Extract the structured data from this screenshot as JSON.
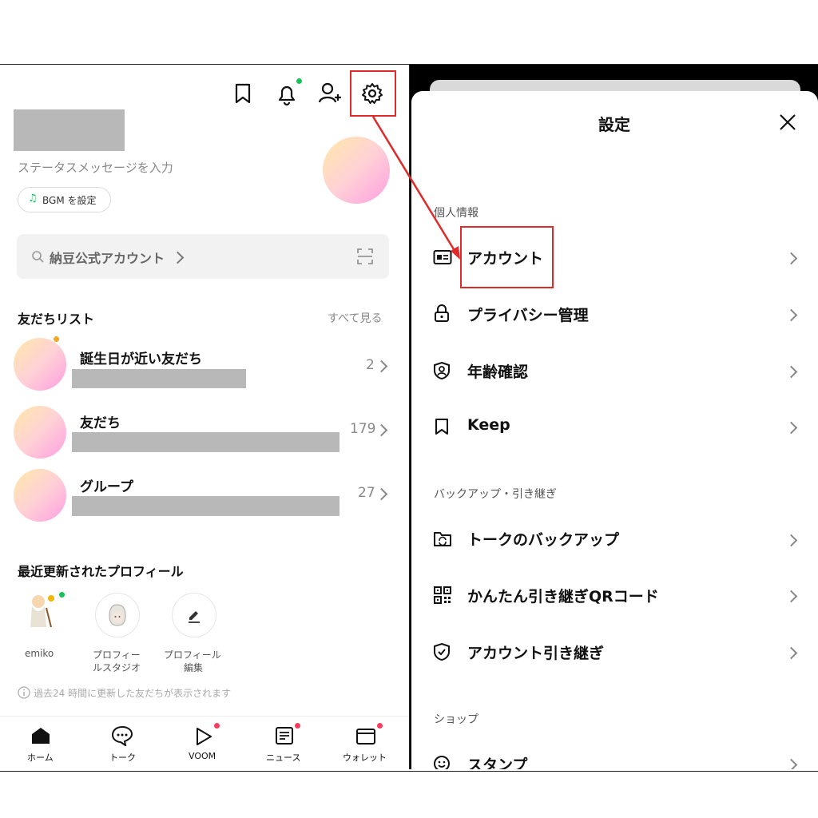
{
  "left": {
    "status_placeholder": "ステータスメッセージを入力",
    "bgm_button": "BGM を設定",
    "search_text": "納豆公式アカウント",
    "friends_header": "友だちリスト",
    "see_all": "すべて見る",
    "friend_groups": [
      {
        "label": "誕生日が近い友だち",
        "count": "2"
      },
      {
        "label": "友だち",
        "count": "179"
      },
      {
        "label": "グループ",
        "count": "27"
      }
    ],
    "recent_header": "最近更新されたプロフィール",
    "recent_items": [
      {
        "label": "emiko"
      },
      {
        "label_line1": "プロフィー",
        "label_line2": "ルスタジオ"
      },
      {
        "label_line1": "プロフィール",
        "label_line2": "編集"
      }
    ],
    "info_note": "過去24 時間に更新した友だちが表示されます",
    "bottom_nav": [
      {
        "label": "ホーム",
        "icon": "home-icon"
      },
      {
        "label": "トーク",
        "icon": "chat-icon"
      },
      {
        "label": "VOOM",
        "icon": "play-icon"
      },
      {
        "label": "ニュース",
        "icon": "news-icon"
      },
      {
        "label": "ウォレット",
        "icon": "wallet-icon"
      }
    ]
  },
  "settings": {
    "title": "設定",
    "sections": [
      {
        "label": "個人情報",
        "items": [
          {
            "label": "アカウント",
            "icon": "id-card-icon"
          },
          {
            "label": "プライバシー管理",
            "icon": "lock-icon"
          },
          {
            "label": "年齢確認",
            "icon": "shield-person-icon"
          },
          {
            "label": "Keep",
            "icon": "bookmark-icon"
          }
        ]
      },
      {
        "label": "バックアップ・引き継ぎ",
        "items": [
          {
            "label": "トークのバックアップ",
            "icon": "folder-refresh-icon"
          },
          {
            "label": "かんたん引き継ぎQRコード",
            "icon": "qr-code-icon"
          },
          {
            "label": "アカウント引き継ぎ",
            "icon": "shield-check-icon"
          }
        ]
      },
      {
        "label": "ショップ",
        "items": [
          {
            "label": "スタンプ",
            "icon": "smiley-icon"
          }
        ]
      }
    ]
  },
  "colors": {
    "highlight": "#e02a2a",
    "notification_green": "#19c15a",
    "notification_red": "#ff3b5c"
  }
}
